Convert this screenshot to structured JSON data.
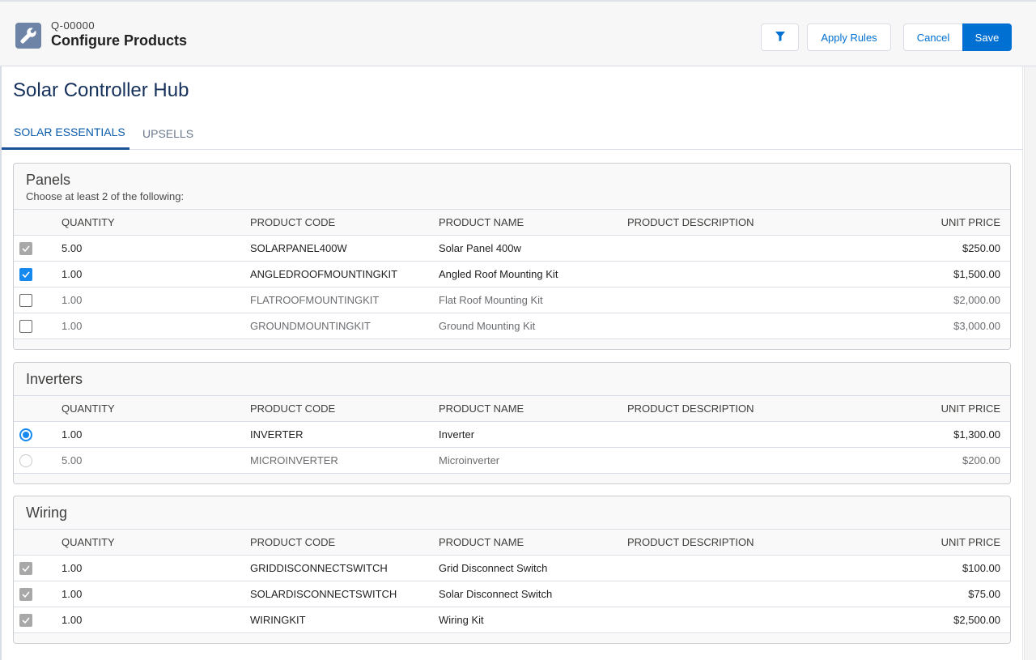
{
  "header": {
    "record_id": "Q-00000",
    "title": "Configure Products",
    "icon": "wrench-icon",
    "buttons": {
      "filter_icon": "filter-icon",
      "apply_rules": "Apply Rules",
      "cancel": "Cancel",
      "save": "Save"
    }
  },
  "colors": {
    "brand": "#0070d2",
    "selected": "#1589ee",
    "header_icon_bg": "#6d84a6"
  },
  "page": {
    "title": "Solar Controller Hub",
    "tabs": [
      {
        "label": "SOLAR ESSENTIALS",
        "active": true
      },
      {
        "label": "UPSELLS",
        "active": false
      }
    ]
  },
  "columns": [
    "QUANTITY",
    "PRODUCT CODE",
    "PRODUCT NAME",
    "PRODUCT DESCRIPTION",
    "UNIT PRICE"
  ],
  "sections": [
    {
      "title": "Panels",
      "description": "Choose at least 2 of the following:",
      "selection": "checkbox",
      "rows": [
        {
          "state": "locked",
          "quantity": "5.00",
          "code": "SOLARPANEL400W",
          "name": "Solar Panel 400w",
          "description": "",
          "price": "$250.00"
        },
        {
          "state": "checked",
          "quantity": "1.00",
          "code": "ANGLEDROOFMOUNTINGKIT",
          "name": "Angled Roof Mounting Kit",
          "description": "",
          "price": "$1,500.00"
        },
        {
          "state": "unchecked",
          "quantity": "1.00",
          "code": "FLATROOFMOUNTINGKIT",
          "name": "Flat Roof Mounting Kit",
          "description": "",
          "price": "$2,000.00"
        },
        {
          "state": "unchecked",
          "quantity": "1.00",
          "code": "GROUNDMOUNTINGKIT",
          "name": "Ground Mounting Kit",
          "description": "",
          "price": "$3,000.00"
        }
      ]
    },
    {
      "title": "Inverters",
      "description": "",
      "selection": "radio",
      "rows": [
        {
          "state": "checked",
          "quantity": "1.00",
          "code": "INVERTER",
          "name": "Inverter",
          "description": "",
          "price": "$1,300.00"
        },
        {
          "state": "unchecked",
          "quantity": "5.00",
          "code": "MICROINVERTER",
          "name": "Microinverter",
          "description": "",
          "price": "$200.00"
        }
      ]
    },
    {
      "title": "Wiring",
      "description": "",
      "selection": "checkbox",
      "rows": [
        {
          "state": "locked",
          "quantity": "1.00",
          "code": "GRIDDISCONNECTSWITCH",
          "name": "Grid Disconnect Switch",
          "description": "",
          "price": "$100.00"
        },
        {
          "state": "locked",
          "quantity": "1.00",
          "code": "SOLARDISCONNECTSWITCH",
          "name": "Solar Disconnect Switch",
          "description": "",
          "price": "$75.00"
        },
        {
          "state": "locked",
          "quantity": "1.00",
          "code": "WIRINGKIT",
          "name": "Wiring Kit",
          "description": "",
          "price": "$2,500.00"
        }
      ]
    }
  ]
}
